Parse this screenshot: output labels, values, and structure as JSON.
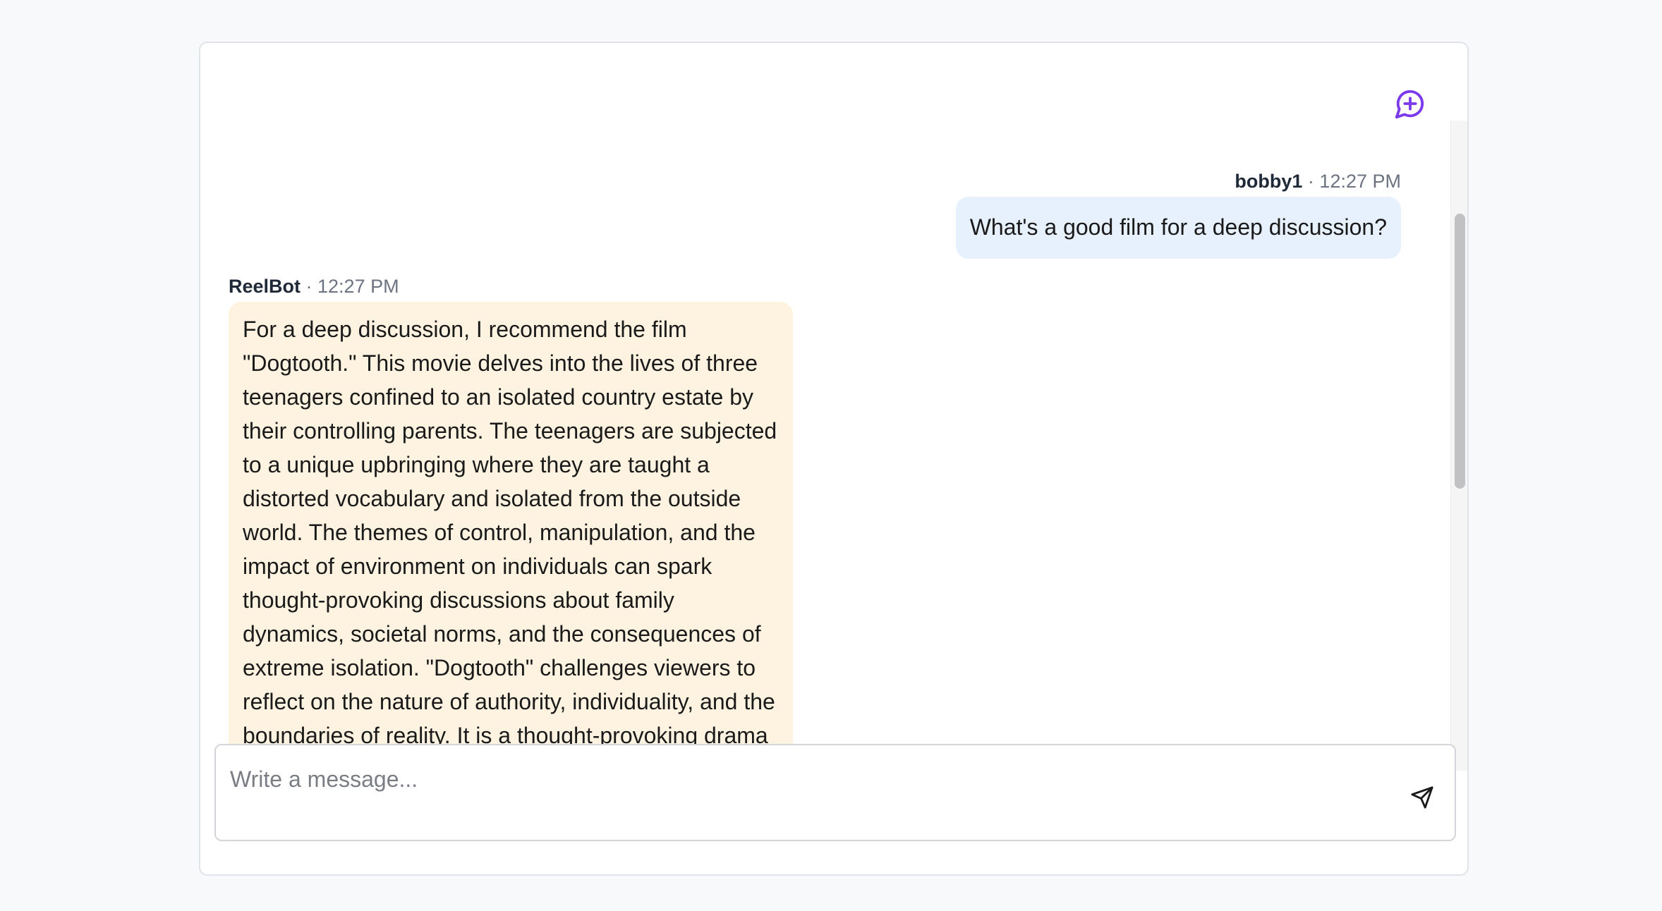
{
  "header": {
    "new_chat_icon": "message-circle-plus-icon",
    "accent_color": "#7c3aed"
  },
  "messages": [
    {
      "author": "bobby1",
      "separator": " · ",
      "time": "12:27 PM",
      "text": "What's a good film for a deep discussion?",
      "bubble_color": "#e6f1fd"
    },
    {
      "author": "ReelBot",
      "separator": " · ",
      "time": "12:27 PM",
      "text": "For a deep discussion, I recommend the film \"Dogtooth.\" This movie delves into the lives of three teenagers confined to an isolated country estate by their controlling parents. The teenagers are subjected to a unique upbringing where they are taught a distorted vocabulary and isolated from the outside world. The themes of control, manipulation, and the impact of environment on individuals can spark thought-provoking discussions about family dynamics, societal norms, and the consequences of extreme isolation. \"Dogtooth\" challenges viewers to reflect on the nature of authority, individuality, and the boundaries of reality. It is a thought-provoking drama that can lead to engaging conversations about human",
      "bubble_color": "#fef3e0"
    }
  ],
  "composer": {
    "placeholder": "Write a message...",
    "value": "",
    "send_icon": "send-icon"
  }
}
